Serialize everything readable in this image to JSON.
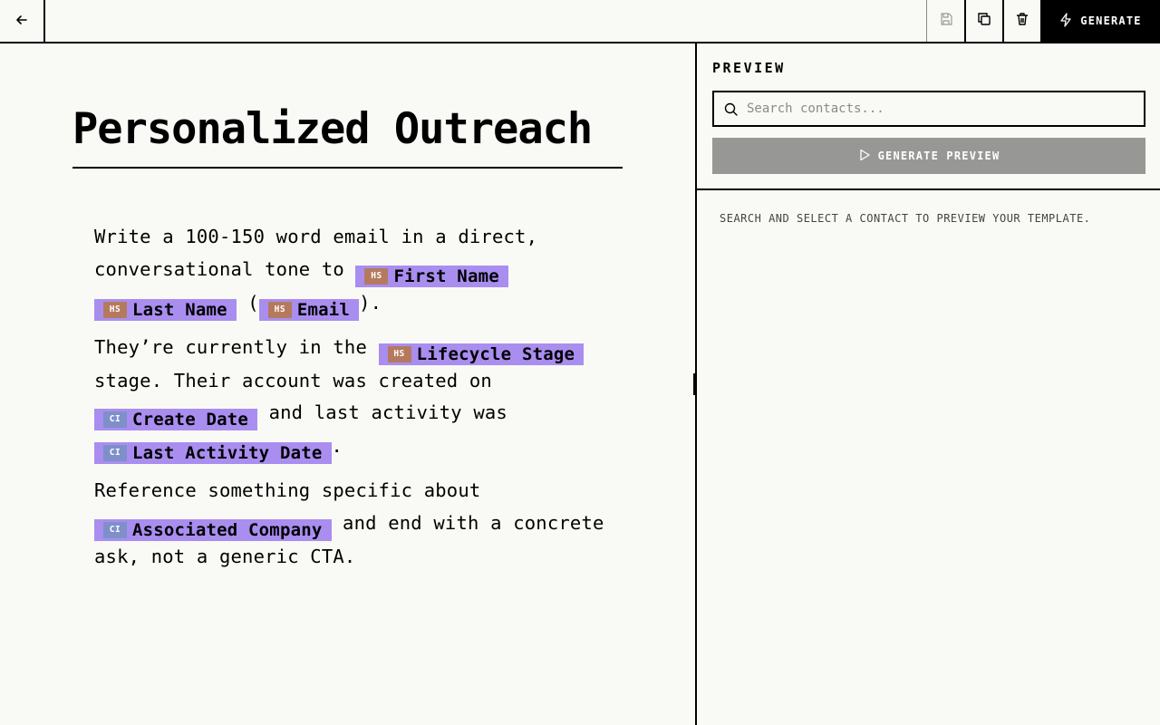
{
  "toolbar": {
    "back_icon": "arrow-left-icon",
    "save_icon": "save-icon",
    "duplicate_icon": "copy-icon",
    "delete_icon": "trash-icon",
    "generate_label": "GENERATE",
    "generate_icon": "lightning-icon"
  },
  "document": {
    "title": "Personalized Outreach",
    "paragraphs": [
      {
        "t1": "Write a 100-150 word email in a direct, conversational tone to ",
        "t2": " ",
        "t3": " (",
        "t4": ")."
      },
      {
        "t1": "They’re currently in the ",
        "t2": " stage. Their account was created on ",
        "t3": " and last activity was ",
        "t4": "."
      },
      {
        "t1": "Reference something specific about ",
        "t2": " and end with a concrete ask, not a generic CTA."
      }
    ],
    "variables": {
      "first_name": {
        "source": "HS",
        "label": "First Name"
      },
      "last_name": {
        "source": "HS",
        "label": "Last Name"
      },
      "email": {
        "source": "HS",
        "label": "Email"
      },
      "lifecycle_stage": {
        "source": "HS",
        "label": "Lifecycle Stage"
      },
      "create_date": {
        "source": "CI",
        "label": "Create Date"
      },
      "last_activity_date": {
        "source": "CI",
        "label": "Last Activity Date"
      },
      "associated_company": {
        "source": "CI",
        "label": "Associated Company"
      }
    }
  },
  "preview": {
    "label": "PREVIEW",
    "search_placeholder": "Search contacts...",
    "generate_preview_label": "GENERATE PREVIEW",
    "empty_message": "SEARCH AND SELECT A CONTACT TO PREVIEW YOUR TEMPLATE."
  },
  "colors": {
    "background": "#f9f9f5",
    "chip": "#a98ef0",
    "hs_badge": "#b57a5e",
    "ci_badge": "#7f8fc9",
    "generate_bg": "#000000",
    "preview_button_disabled": "#979795"
  }
}
